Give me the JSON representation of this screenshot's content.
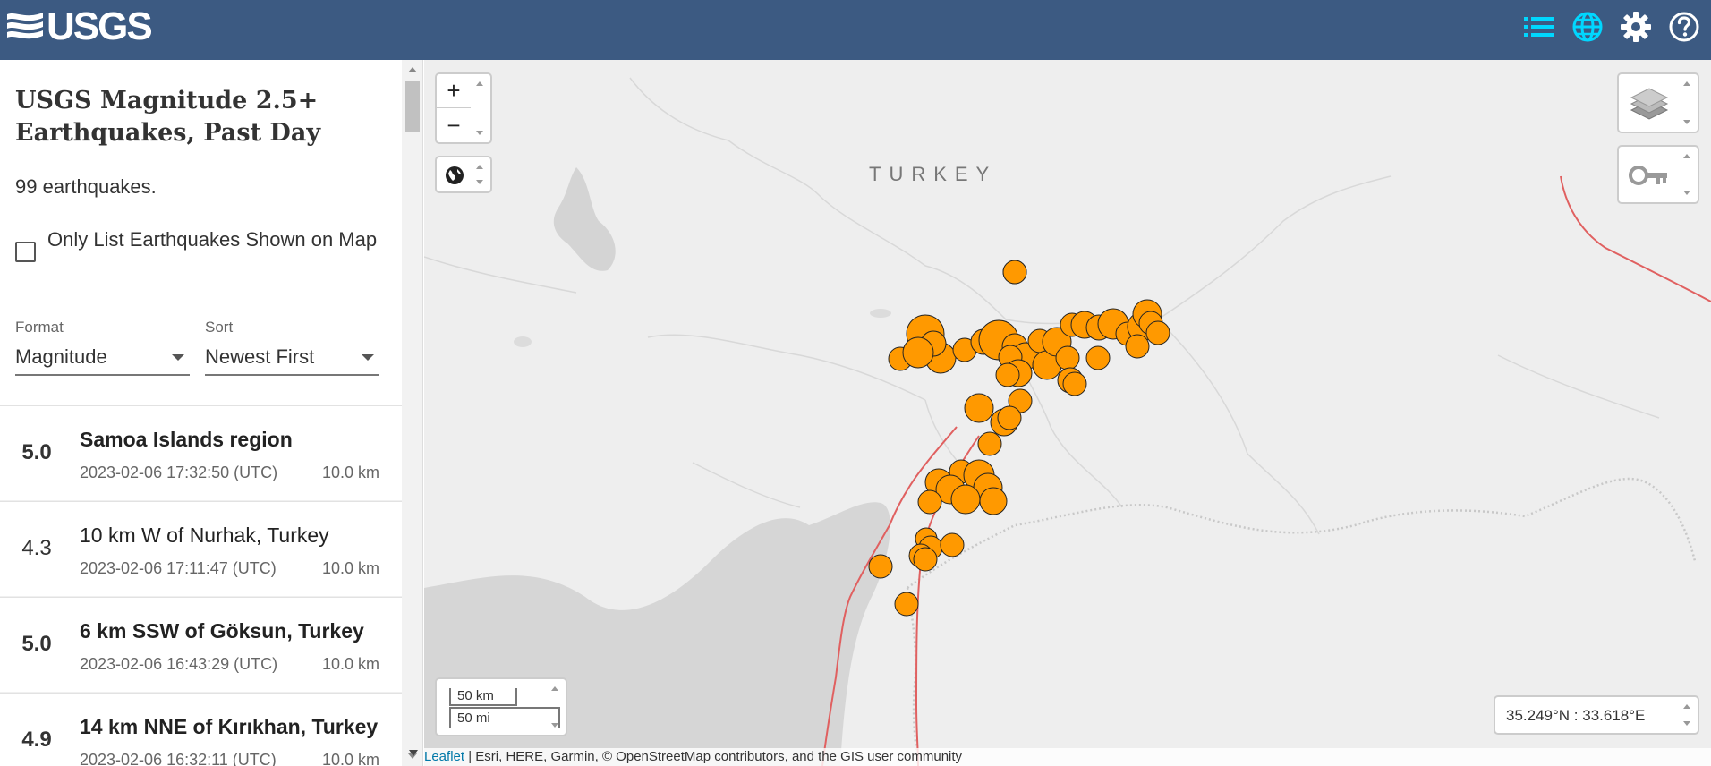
{
  "header": {
    "logo_text": "USGS",
    "icons": [
      "list-icon",
      "globe-icon",
      "gear-icon",
      "help-icon"
    ],
    "active_color": "#00d7ff",
    "background": "#3c5a82"
  },
  "sidebar": {
    "title": "USGS Magnitude 2.5+ Earthquakes, Past Day",
    "count": "99 earthquakes.",
    "checkbox_label": "Only List Earthquakes Shown on Map",
    "format_caption": "Format",
    "format_value": "Magnitude",
    "sort_caption": "Sort",
    "sort_value": "Newest First"
  },
  "quakes": [
    {
      "mag": "5.0",
      "place": "Samoa Islands region",
      "time": "2023-02-06 17:32:50 (UTC)",
      "depth": "10.0 km",
      "bold": true
    },
    {
      "mag": "4.3",
      "place": "10 km W of Nurhak, Turkey",
      "time": "2023-02-06 17:11:47 (UTC)",
      "depth": "10.0 km",
      "bold": false
    },
    {
      "mag": "5.0",
      "place": "6 km SSW of Göksun, Turkey",
      "time": "2023-02-06 16:43:29 (UTC)",
      "depth": "10.0 km",
      "bold": true
    },
    {
      "mag": "4.9",
      "place": "14 km NNE of Kırıkhan, Turkey",
      "time": "2023-02-06 16:32:11 (UTC)",
      "depth": "10.0 km",
      "bold": true
    }
  ],
  "map": {
    "country_label": "TURKEY",
    "zoom_in": "+",
    "zoom_out": "−",
    "scale_km": "50 km",
    "scale_mi": "50 mi",
    "coordinates": "35.249°N : 33.618°E",
    "attribution_link": "Leaflet",
    "attribution_text": " | Esri, HERE, Garmin, © OpenStreetMap contributors, and the GIS user community",
    "marker_color": "#ff9900",
    "fault_color": "#e06060"
  }
}
